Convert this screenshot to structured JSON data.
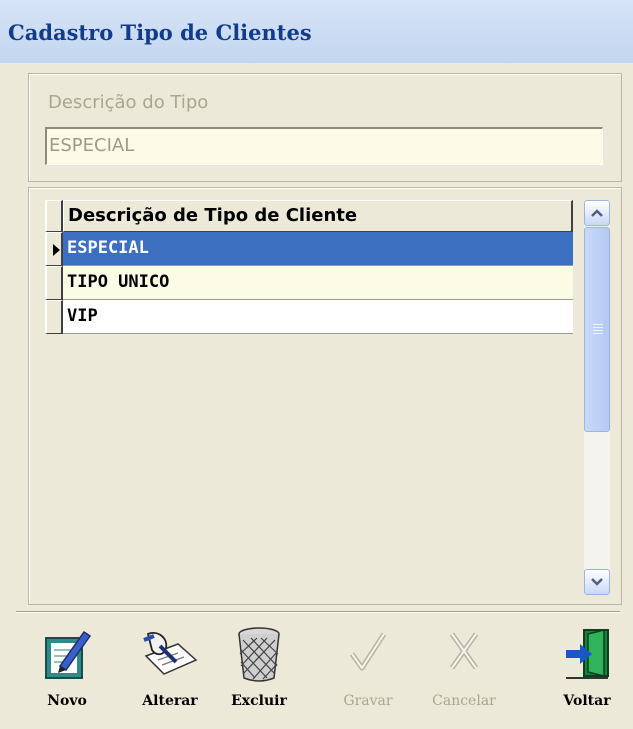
{
  "window": {
    "title": "Cadastro Tipo de Clientes"
  },
  "form": {
    "field_label": "Descrição do Tipo",
    "field_value": "ESPECIAL"
  },
  "grid": {
    "column_header": "Descrição de Tipo de Cliente",
    "rows": [
      {
        "value": "ESPECIAL",
        "selected": true
      },
      {
        "value": "TIPO UNICO",
        "selected": false
      },
      {
        "value": "VIP",
        "selected": false
      }
    ]
  },
  "toolbar": {
    "buttons": [
      {
        "label": "Novo",
        "icon": "notepad-pencil-icon",
        "enabled": true
      },
      {
        "label": "Alterar",
        "icon": "hand-writing-icon",
        "enabled": true
      },
      {
        "label": "Excluir",
        "icon": "trash-bin-icon",
        "enabled": true
      },
      {
        "label": "Gravar",
        "icon": "checkmark-icon",
        "enabled": false
      },
      {
        "label": "Cancelar",
        "icon": "x-mark-icon",
        "enabled": false
      },
      {
        "label": "Voltar",
        "icon": "exit-door-icon",
        "enabled": true
      }
    ]
  },
  "colors": {
    "title_text": "#113c8c",
    "selected_row": "#3c6fbf",
    "alt_row": "#fcfbe6",
    "window_bg": "#ece9d8"
  }
}
